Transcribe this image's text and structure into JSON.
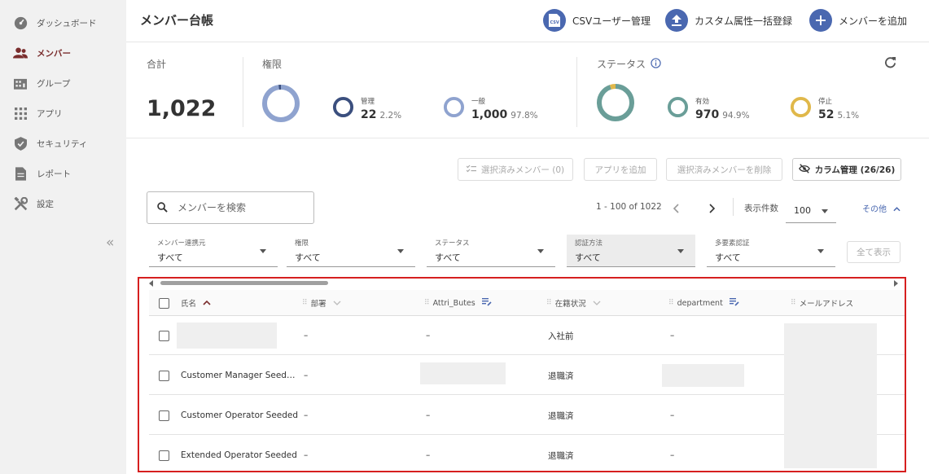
{
  "sidebar": {
    "items": [
      {
        "label": "ダッシュボード",
        "icon": "dashboard-icon"
      },
      {
        "label": "メンバー",
        "icon": "members-icon"
      },
      {
        "label": "グループ",
        "icon": "group-icon"
      },
      {
        "label": "アプリ",
        "icon": "apps-grid-icon"
      },
      {
        "label": "セキュリティ",
        "icon": "shield-icon"
      },
      {
        "label": "レポート",
        "icon": "report-icon"
      },
      {
        "label": "設定",
        "icon": "settings-tools-icon"
      }
    ],
    "collapse_label": "«"
  },
  "header": {
    "title": "メンバー台帳",
    "csv_label": "CSVユーザー管理",
    "bulk_label": "カスタム属性一括登録",
    "add_label": "メンバーを追加"
  },
  "stats": {
    "total_label": "合計",
    "total_value": "1,022",
    "role_label": "権限",
    "admin": {
      "label": "管理",
      "value": "22",
      "pct": "2.2%",
      "fraction": 0.022
    },
    "general": {
      "label": "一般",
      "value": "1,000",
      "pct": "97.8%",
      "fraction": 0.978
    },
    "status_label": "ステータス",
    "active": {
      "label": "有効",
      "value": "970",
      "pct": "94.9%",
      "fraction": 0.949
    },
    "stopped": {
      "label": "停止",
      "value": "52",
      "pct": "5.1%",
      "fraction": 0.051
    }
  },
  "toolbar": {
    "selected_label": "選択済みメンバー (0)",
    "add_app_label": "アプリを追加",
    "delete_label": "選択済みメンバーを削除",
    "column_label": "カラム管理 (26/26)"
  },
  "search": {
    "placeholder": "メンバーを検索"
  },
  "pager": {
    "range": "1 - 100 of 1022",
    "per_page_label": "表示件数",
    "per_page_value": "100",
    "more_label": "その他"
  },
  "filters": [
    {
      "label": "メンバー連携元",
      "value": "すべて"
    },
    {
      "label": "権限",
      "value": "すべて"
    },
    {
      "label": "ステータス",
      "value": "すべて"
    },
    {
      "label": "認証方法",
      "value": "すべて"
    },
    {
      "label": "多要素認証",
      "value": "すべて"
    }
  ],
  "show_all_label": "全て表示",
  "table": {
    "columns": [
      "氏名",
      "部署",
      "Attri_Butes",
      "在籍状況",
      "department",
      "メールアドレス"
    ],
    "rows": [
      {
        "name": "",
        "dept": "–",
        "attr": "–",
        "status": "入社前",
        "department": "–"
      },
      {
        "name": "Customer Manager Seed…",
        "dept": "–",
        "attr": "",
        "status": "退職済",
        "department": ""
      },
      {
        "name": "Customer Operator Seeded",
        "dept": "–",
        "attr": "–",
        "status": "退職済",
        "department": "–"
      },
      {
        "name": "Extended Operator Seeded",
        "dept": "–",
        "attr": "–",
        "status": "退職済",
        "department": "–"
      }
    ]
  },
  "colors": {
    "accent": "#4a68b0",
    "brand": "#7a2d2d",
    "active": "#6a9e98",
    "stopped": "#e0b84a",
    "admin": "#3b4f7e",
    "general": "#8fa3cf",
    "highlight": "#d61f1f"
  }
}
